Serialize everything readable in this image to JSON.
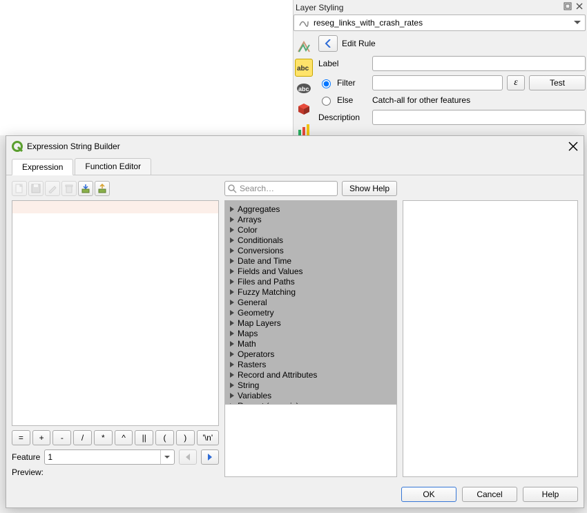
{
  "layer_panel": {
    "title": "Layer Styling",
    "layer_name": "reseg_links_with_crash_rates",
    "edit_rule": "Edit Rule",
    "label_label": "Label",
    "filter_label": "Filter",
    "else_label": "Else",
    "else_desc": "Catch-all for other features",
    "description_label": "Description",
    "test_label": "Test",
    "label_value": "",
    "filter_value": "",
    "description_value": ""
  },
  "dialog": {
    "title": "Expression String Builder",
    "tabs": {
      "expression": "Expression",
      "function_editor": "Function Editor"
    },
    "search_placeholder": "Search…",
    "show_help": "Show Help",
    "feature_label": "Feature",
    "feature_value": "1",
    "preview_label": "Preview:",
    "ops": [
      "=",
      "+",
      "-",
      "/",
      "*",
      "^",
      "||",
      "(",
      ")",
      "'\\n'"
    ],
    "categories": [
      "Aggregates",
      "Arrays",
      "Color",
      "Conditionals",
      "Conversions",
      "Date and Time",
      "Fields and Values",
      "Files and Paths",
      "Fuzzy Matching",
      "General",
      "Geometry",
      "Map Layers",
      "Maps",
      "Math",
      "Operators",
      "Rasters",
      "Record and Attributes",
      "String",
      "Variables",
      "Recent (generic)"
    ],
    "footer": {
      "ok": "OK",
      "cancel": "Cancel",
      "help": "Help"
    }
  }
}
